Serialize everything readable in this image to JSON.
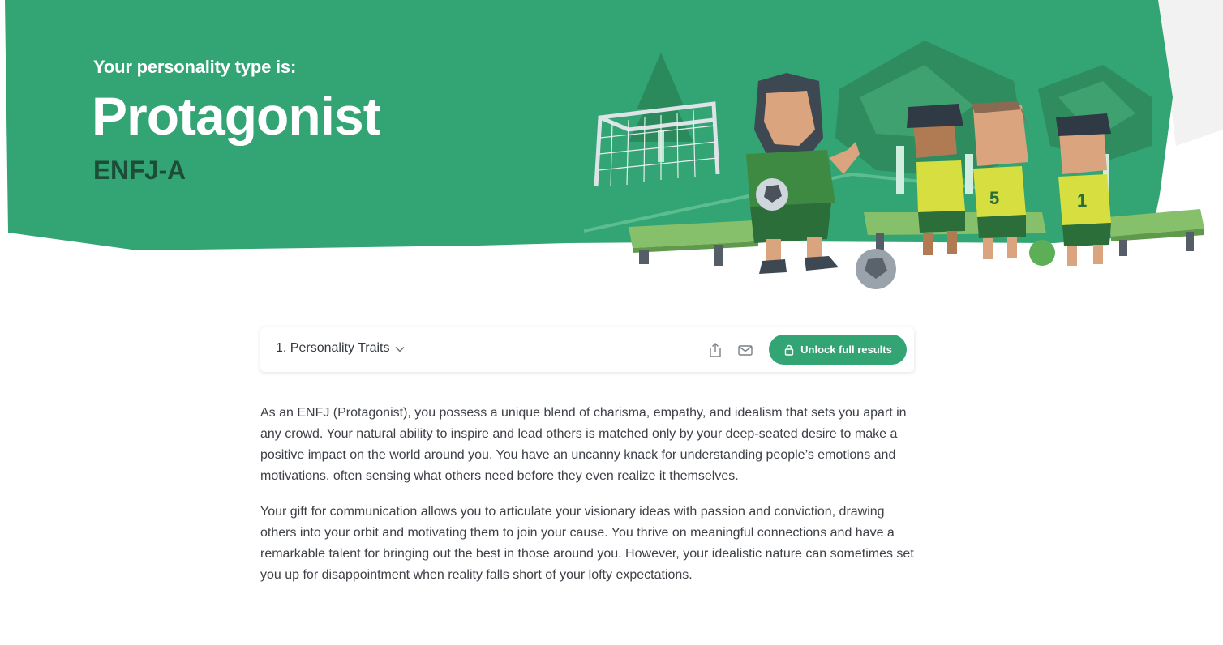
{
  "hero": {
    "eyebrow": "Your personality type is:",
    "title": "Protagonist",
    "code": "ENFJ-A"
  },
  "toolbar": {
    "section_label": "1. Personality Traits",
    "share_icon": "share-icon",
    "email_icon": "mail-icon",
    "unlock_label": "Unlock full results",
    "lock_icon": "lock-icon"
  },
  "content": {
    "paragraphs": [
      "As an ENFJ (Protagonist), you possess a unique blend of charisma, empathy, and idealism that sets you apart in any crowd. Your natural ability to inspire and lead others is matched only by your deep-seated desire to make a positive impact on the world around you. You have an uncanny knack for understanding people’s emotions and motivations, often sensing what others need before they even realize it themselves.",
      "Your gift for communication allows you to articulate your visionary ideas with passion and conviction, drawing others into your orbit and motivating them to join your cause. You thrive on meaningful connections and have a remarkable talent for bringing out the best in those around you. However, your idealistic nature can sometimes set you up for disappointment when reality falls short of your lofty expectations."
    ]
  },
  "colors": {
    "brand_green": "#33a474",
    "dark_green": "#1d4d36",
    "text": "#3d4147"
  }
}
